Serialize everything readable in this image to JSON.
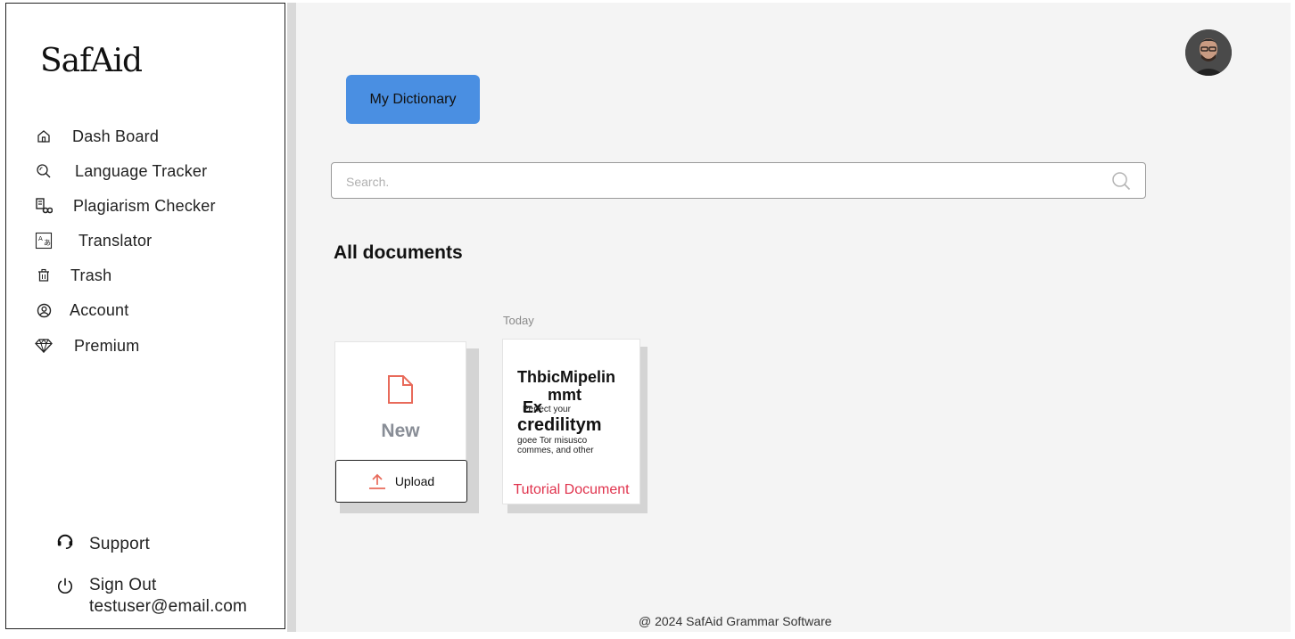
{
  "brand": {
    "logo_text": "SafAid"
  },
  "sidebar": {
    "items": [
      {
        "label": "Dash Board",
        "icon": "home-icon"
      },
      {
        "label": "Language Tracker",
        "icon": "search-magnify-icon"
      },
      {
        "label": "Plagiarism Checker",
        "icon": "plagiarism-icon"
      },
      {
        "label": "Translator",
        "icon": "translate-icon"
      },
      {
        "label": "Trash",
        "icon": "trash-icon"
      },
      {
        "label": "Account",
        "icon": "user-circle-icon"
      },
      {
        "label": "Premium",
        "icon": "diamond-icon"
      }
    ],
    "support_label": "Support",
    "signout_label": "Sign Out",
    "user_email": "testuser@email.com"
  },
  "header": {
    "dictionary_button": "My Dictionary"
  },
  "search": {
    "placeholder": "Search."
  },
  "documents": {
    "section_title": "All documents",
    "date_group": "Today",
    "new_card": {
      "label": "New",
      "upload_label": "Upload"
    },
    "doc_card": {
      "preview_line1": "ThbicMipelin",
      "preview_line2": "mmt",
      "preview_overlap": "Ex",
      "preview_small1": "Perfect your",
      "preview_line3": "credilitym",
      "preview_small2": "goee Tor misusco",
      "preview_small3": "commes, and other",
      "name": "Tutorial Document"
    }
  },
  "footer": {
    "text": "@ 2024  SafAid Grammar Software"
  },
  "colors": {
    "accent": "#4a8fe2",
    "doc_name": "#e0334d",
    "upload_icon": "#e86a5a"
  }
}
